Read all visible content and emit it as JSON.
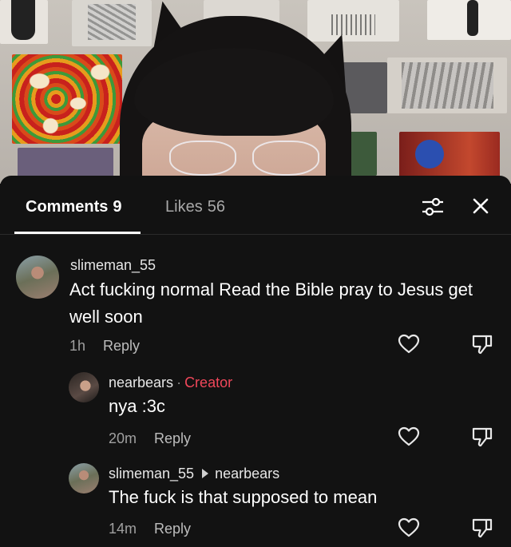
{
  "tabs": {
    "comments_label": "Comments",
    "comments_count": "9",
    "likes_label": "Likes",
    "likes_count": "56"
  },
  "icons": {
    "filter": "sliders-icon",
    "close": "close-icon",
    "like": "heart-icon",
    "dislike": "thumbs-down-icon"
  },
  "comments": [
    {
      "username": "slimeman_55",
      "text": "Act fucking normal Read the Bible pray to Jesus get well soon",
      "time": "1h",
      "reply_label": "Reply"
    },
    {
      "username": "nearbears",
      "badge": "Creator",
      "text": "nya :3c",
      "time": "20m",
      "reply_label": "Reply"
    },
    {
      "username": "slimeman_55",
      "reply_to": "nearbears",
      "text": "The fuck is that supposed to mean",
      "time": "14m",
      "reply_label": "Reply"
    }
  ],
  "colors": {
    "sheet_bg": "#121212",
    "creator_badge": "#f0475a",
    "muted_text": "#a0a0a0"
  }
}
